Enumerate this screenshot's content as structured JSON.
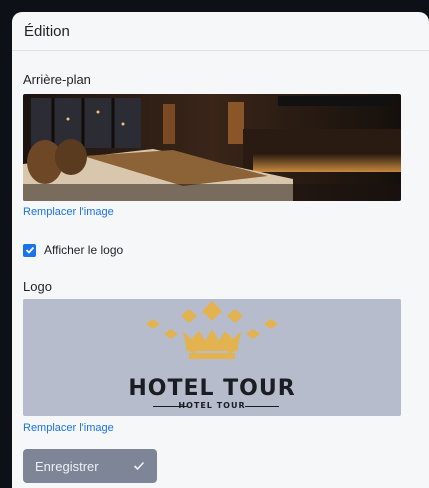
{
  "panel": {
    "title": "Édition"
  },
  "background": {
    "label": "Arrière-plan",
    "replace_link": "Remplacer l'image"
  },
  "show_logo": {
    "label": "Afficher le logo",
    "checked": true
  },
  "logo": {
    "label": "Logo",
    "brand_name": "HOTEL TOUR",
    "brand_tagline": "HOTEL TOUR",
    "replace_link": "Remplacer l'image"
  },
  "actions": {
    "save_label": "Enregistrer",
    "save_icon": "check-icon"
  },
  "colors": {
    "accent": "#1a73e8",
    "logo_gold": "#e2b34f",
    "button_bg": "#7e8596"
  }
}
